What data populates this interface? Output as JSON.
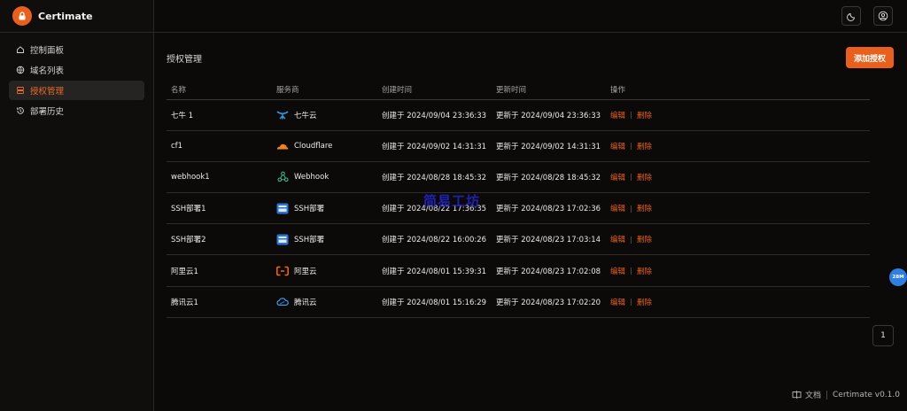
{
  "app": {
    "name": "Certimate",
    "accent": "#e8601c"
  },
  "sidebar": {
    "items": [
      {
        "label": "控制面板",
        "icon": "home-icon"
      },
      {
        "label": "域名列表",
        "icon": "globe-icon"
      },
      {
        "label": "授权管理",
        "icon": "server-icon",
        "active": true
      },
      {
        "label": "部署历史",
        "icon": "history-icon"
      }
    ]
  },
  "header": {
    "theme_icon": "moon-icon",
    "user_icon": "user-circle-icon"
  },
  "page": {
    "title": "授权管理",
    "add_button": "添加授权"
  },
  "table": {
    "columns": [
      "名称",
      "服务商",
      "创建时间",
      "更新时间",
      "操作"
    ],
    "edit_label": "编辑",
    "delete_label": "删除",
    "rows": [
      {
        "name": "七牛 1",
        "provider": "七牛云",
        "provider_icon": "qiniu-icon",
        "created": "创建于 2024/09/04 23:36:33",
        "updated": "更新于 2024/09/04 23:36:33"
      },
      {
        "name": "cf1",
        "provider": "Cloudflare",
        "provider_icon": "cloudflare-icon",
        "created": "创建于 2024/09/02 14:31:31",
        "updated": "更新于 2024/09/02 14:31:31"
      },
      {
        "name": "webhook1",
        "provider": "Webhook",
        "provider_icon": "webhook-icon",
        "created": "创建于 2024/08/28 18:45:32",
        "updated": "更新于 2024/08/28 18:45:32"
      },
      {
        "name": "SSH部署1",
        "provider": "SSH部署",
        "provider_icon": "ssh-icon",
        "created": "创建于 2024/08/22 17:36:35",
        "updated": "更新于 2024/08/23 17:02:36"
      },
      {
        "name": "SSH部署2",
        "provider": "SSH部署",
        "provider_icon": "ssh-icon",
        "created": "创建于 2024/08/22 16:00:26",
        "updated": "更新于 2024/08/23 17:03:14"
      },
      {
        "name": "阿里云1",
        "provider": "阿里云",
        "provider_icon": "aliyun-icon",
        "created": "创建于 2024/08/01 15:39:31",
        "updated": "更新于 2024/08/23 17:02:08"
      },
      {
        "name": "腾讯云1",
        "provider": "腾讯云",
        "provider_icon": "tencent-cloud-icon",
        "created": "创建于 2024/08/01 15:16:29",
        "updated": "更新于 2024/08/23 17:02:20"
      }
    ]
  },
  "pagination": {
    "current": "1"
  },
  "footer": {
    "docs_label": "文档",
    "version": "Certimate v0.1.0"
  },
  "overlay": {
    "watermark": "简易工坊",
    "badge": "28M"
  }
}
